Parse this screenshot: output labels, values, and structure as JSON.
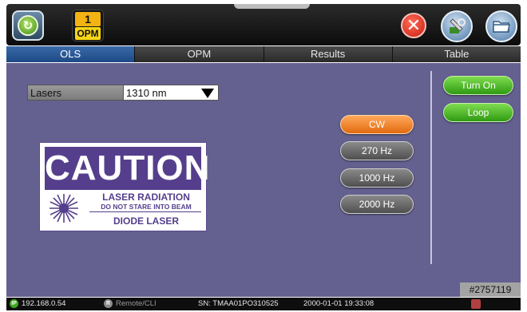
{
  "header": {
    "badge_number": "1",
    "badge_label": "OPM",
    "icons": {
      "home": "home-icon",
      "close": "close-icon",
      "tools": "tools-icon",
      "folder": "folder-icon"
    }
  },
  "tabs": [
    {
      "label": "OLS",
      "active": true
    },
    {
      "label": "OPM",
      "active": false
    },
    {
      "label": "Results",
      "active": false
    },
    {
      "label": "Table",
      "active": false
    }
  ],
  "lasers": {
    "label": "Lasers",
    "selected": "1310 nm"
  },
  "caution": {
    "title": "CAUTION",
    "line1": "LASER RADIATION",
    "line2": "DO NOT STARE INTO BEAM",
    "line3": "DIODE LASER"
  },
  "modes": [
    {
      "label": "CW",
      "selected": true
    },
    {
      "label": "270 Hz",
      "selected": false
    },
    {
      "label": "1000 Hz",
      "selected": false
    },
    {
      "label": "2000 Hz",
      "selected": false
    }
  ],
  "actions": {
    "turn_on": "Turn On",
    "loop": "Loop"
  },
  "serial_tag": "#2757119",
  "status": {
    "ip_badge": "IP",
    "ip": "192.168.0.54",
    "remote_badge": "R",
    "remote": "Remote/CLI",
    "sn": "SN: TMAA01PO310525",
    "datetime": "2000-01-01  19:33:08"
  },
  "colors": {
    "panel": "#64608f",
    "accent_orange": "#e26a10",
    "accent_green": "#2f9a12",
    "caution_purple": "#553f8c"
  }
}
